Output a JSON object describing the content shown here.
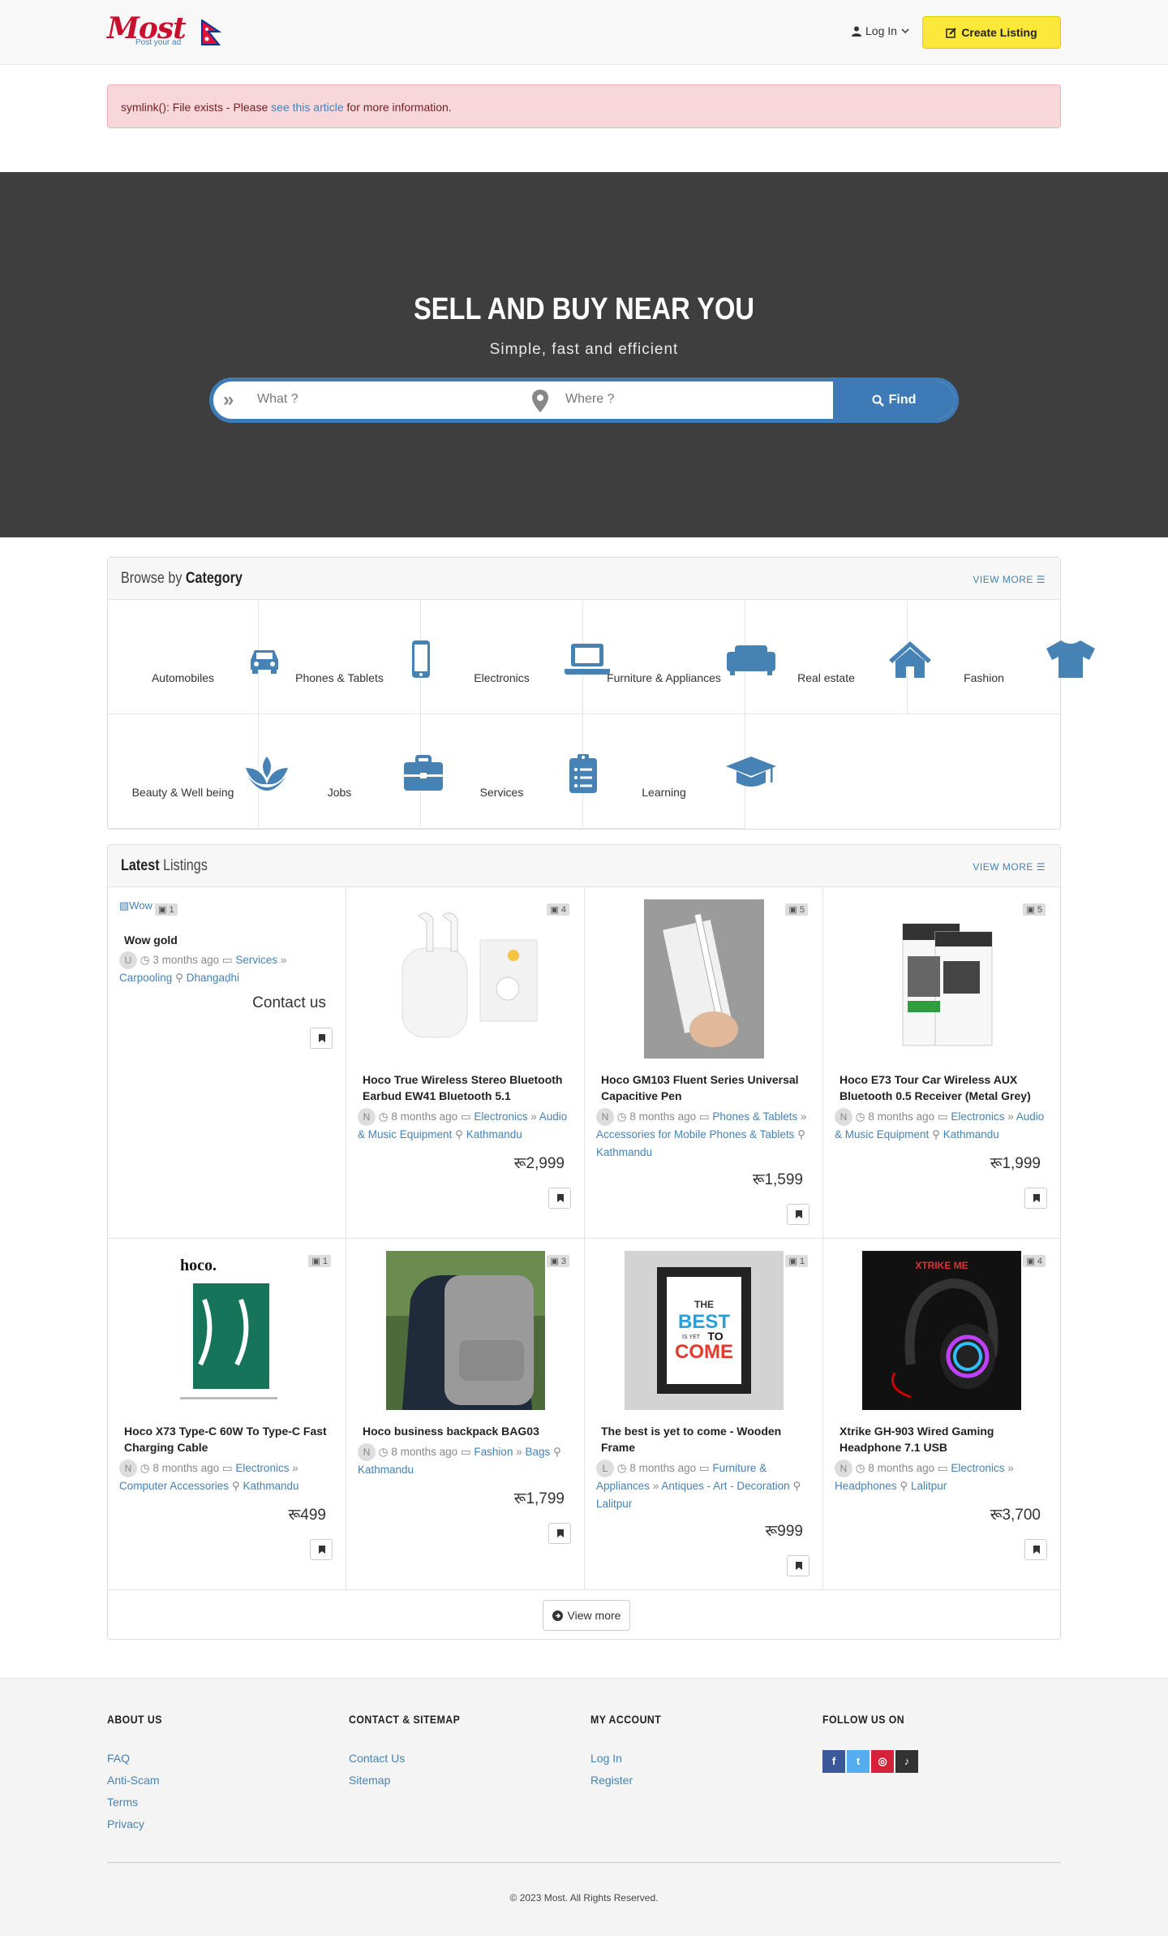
{
  "header": {
    "logo_text": "Most",
    "logo_tagline": "Post your ad",
    "login_label": "Log In",
    "create_listing_label": "Create Listing"
  },
  "alert": {
    "prefix": "symlink(): File exists - Please",
    "link_text": "see this article",
    "suffix": "for more information."
  },
  "hero": {
    "title": "SELL AND BUY NEAR YOU",
    "subtitle": "Simple, fast and efficient",
    "what_placeholder": "What ?",
    "where_placeholder": "Where ?",
    "find_label": "Find"
  },
  "categories": {
    "title_prefix": "Browse by",
    "title_bold": "Category",
    "view_more": "VIEW MORE",
    "items": [
      {
        "label": "Automobiles",
        "icon": "car-icon"
      },
      {
        "label": "Phones & Tablets",
        "icon": "mobile-icon"
      },
      {
        "label": "Electronics",
        "icon": "laptop-icon"
      },
      {
        "label": "Furniture & Appliances",
        "icon": "couch-icon"
      },
      {
        "label": "Real estate",
        "icon": "home-icon"
      },
      {
        "label": "Fashion",
        "icon": "tshirt-icon"
      },
      {
        "label": "Beauty & Well being",
        "icon": "spa-icon"
      },
      {
        "label": "Jobs",
        "icon": "briefcase-icon"
      },
      {
        "label": "Services",
        "icon": "clipboard-list-icon"
      },
      {
        "label": "Learning",
        "icon": "graduation-cap-icon"
      }
    ]
  },
  "latest": {
    "title_bold": "Latest",
    "title_rest": "Listings",
    "view_more": "VIEW MORE",
    "view_more_button": "View more",
    "listings": [
      {
        "title": "Wow gold",
        "photos": "1",
        "avatar": "U",
        "time": "3 months ago",
        "cat1": "Services",
        "cat2": "Carpooling",
        "location": "Dhangaḍhi",
        "price": "Contact us",
        "img_alt": "Wow"
      },
      {
        "title": "Hoco True Wireless Stereo Bluetooth Earbud EW41 Bluetooth 5.1",
        "photos": "4",
        "avatar": "N",
        "time": "8 months ago",
        "cat1": "Electronics",
        "cat2": "Audio & Music Equipment",
        "location": "Kathmandu",
        "price": "रू2,999"
      },
      {
        "title": "Hoco GM103 Fluent Series Universal Capacitive Pen",
        "photos": "5",
        "avatar": "N",
        "time": "8 months ago",
        "cat1": "Phones & Tablets",
        "cat2": "Accessories for Mobile Phones & Tablets",
        "location": "Kathmandu",
        "price": "रू1,599"
      },
      {
        "title": "Hoco E73 Tour Car Wireless AUX Bluetooth 0.5 Receiver (Metal Grey)",
        "photos": "5",
        "avatar": "N",
        "time": "8 months ago",
        "cat1": "Electronics",
        "cat2": "Audio & Music Equipment",
        "location": "Kathmandu",
        "price": "रू1,999"
      },
      {
        "title": "Hoco X73 Type-C 60W To Type-C Fast Charging Cable",
        "photos": "1",
        "avatar": "N",
        "time": "8 months ago",
        "cat1": "Electronics",
        "cat2": "Computer Accessories",
        "location": "Kathmandu",
        "price": "रू499",
        "img_text": "hoco."
      },
      {
        "title": "Hoco business backpack BAG03",
        "photos": "3",
        "avatar": "N",
        "time": "8 months ago",
        "cat1": "Fashion",
        "cat2": "Bags",
        "location": "Kathmandu",
        "price": "रू1,799"
      },
      {
        "title": "The best is yet to come - Wooden Frame",
        "photos": "1",
        "avatar": "L",
        "time": "8 months ago",
        "cat1": "Furniture & Appliances",
        "cat2": "Antiques - Art - Decoration",
        "location": "Lalitpur",
        "price": "रू999",
        "img_lines": [
          "THE",
          "BEST",
          "IS YET",
          "TO",
          "COME"
        ]
      },
      {
        "title": "Xtrike GH-903 Wired Gaming Headphone 7.1 USB",
        "photos": "4",
        "avatar": "N",
        "time": "8 months ago",
        "cat1": "Electronics",
        "cat2": "Headphones",
        "location": "Lalitpur",
        "price": "रू3,700",
        "img_text": "XTRIKE ME"
      }
    ]
  },
  "footer": {
    "about": {
      "heading": "ABOUT US",
      "links": [
        "FAQ",
        "Anti-Scam",
        "Terms",
        "Privacy"
      ]
    },
    "contact": {
      "heading": "CONTACT & SITEMAP",
      "links": [
        "Contact Us",
        "Sitemap"
      ]
    },
    "account": {
      "heading": "MY ACCOUNT",
      "links": [
        "Log In",
        "Register"
      ]
    },
    "follow": {
      "heading": "FOLLOW US ON"
    },
    "social_colors": {
      "facebook": "#3b5998",
      "twitter": "#55acee",
      "instagram": "#d6213b",
      "tiktok": "#333333"
    },
    "copyright": "© 2023 Most. All Rights Reserved."
  },
  "colors": {
    "accent": "#4682b4",
    "create_button": "#fce83a",
    "hero_bg": "#3e3e3e",
    "alert_bg": "#f8d7da"
  }
}
